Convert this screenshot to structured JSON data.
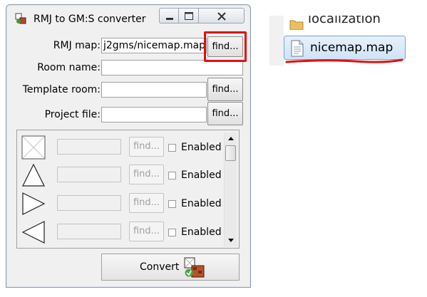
{
  "window": {
    "title": "RMJ to GM:S converter"
  },
  "form": {
    "rmj_map": {
      "label": "RMJ map:",
      "value": "j2gms/nicemap.map",
      "button": "find..."
    },
    "room_name": {
      "label": "Room name:",
      "value": ""
    },
    "template_room": {
      "label": "Template room:",
      "value": "",
      "button": "find..."
    },
    "project_file": {
      "label": "Project file:",
      "value": "",
      "button": "find..."
    }
  },
  "layers": [
    {
      "icon": "empty-box-icon",
      "value": "",
      "button": "find...",
      "checkbox_label": "Enabled",
      "checked": false
    },
    {
      "icon": "triangle-up-icon",
      "value": "",
      "button": "find...",
      "checkbox_label": "Enabled",
      "checked": false
    },
    {
      "icon": "triangle-right-icon",
      "value": "",
      "button": "find...",
      "checkbox_label": "Enabled",
      "checked": false
    },
    {
      "icon": "triangle-left-icon",
      "value": "",
      "button": "find...",
      "checkbox_label": "Enabled",
      "checked": false
    }
  ],
  "convert": {
    "label": "Convert",
    "icon": "convert-icon"
  },
  "explorer": {
    "folder_name": "localization",
    "file_name": "nicemap.map"
  },
  "colors": {
    "highlight": "#e01010",
    "selection": "#cfe3f7"
  }
}
